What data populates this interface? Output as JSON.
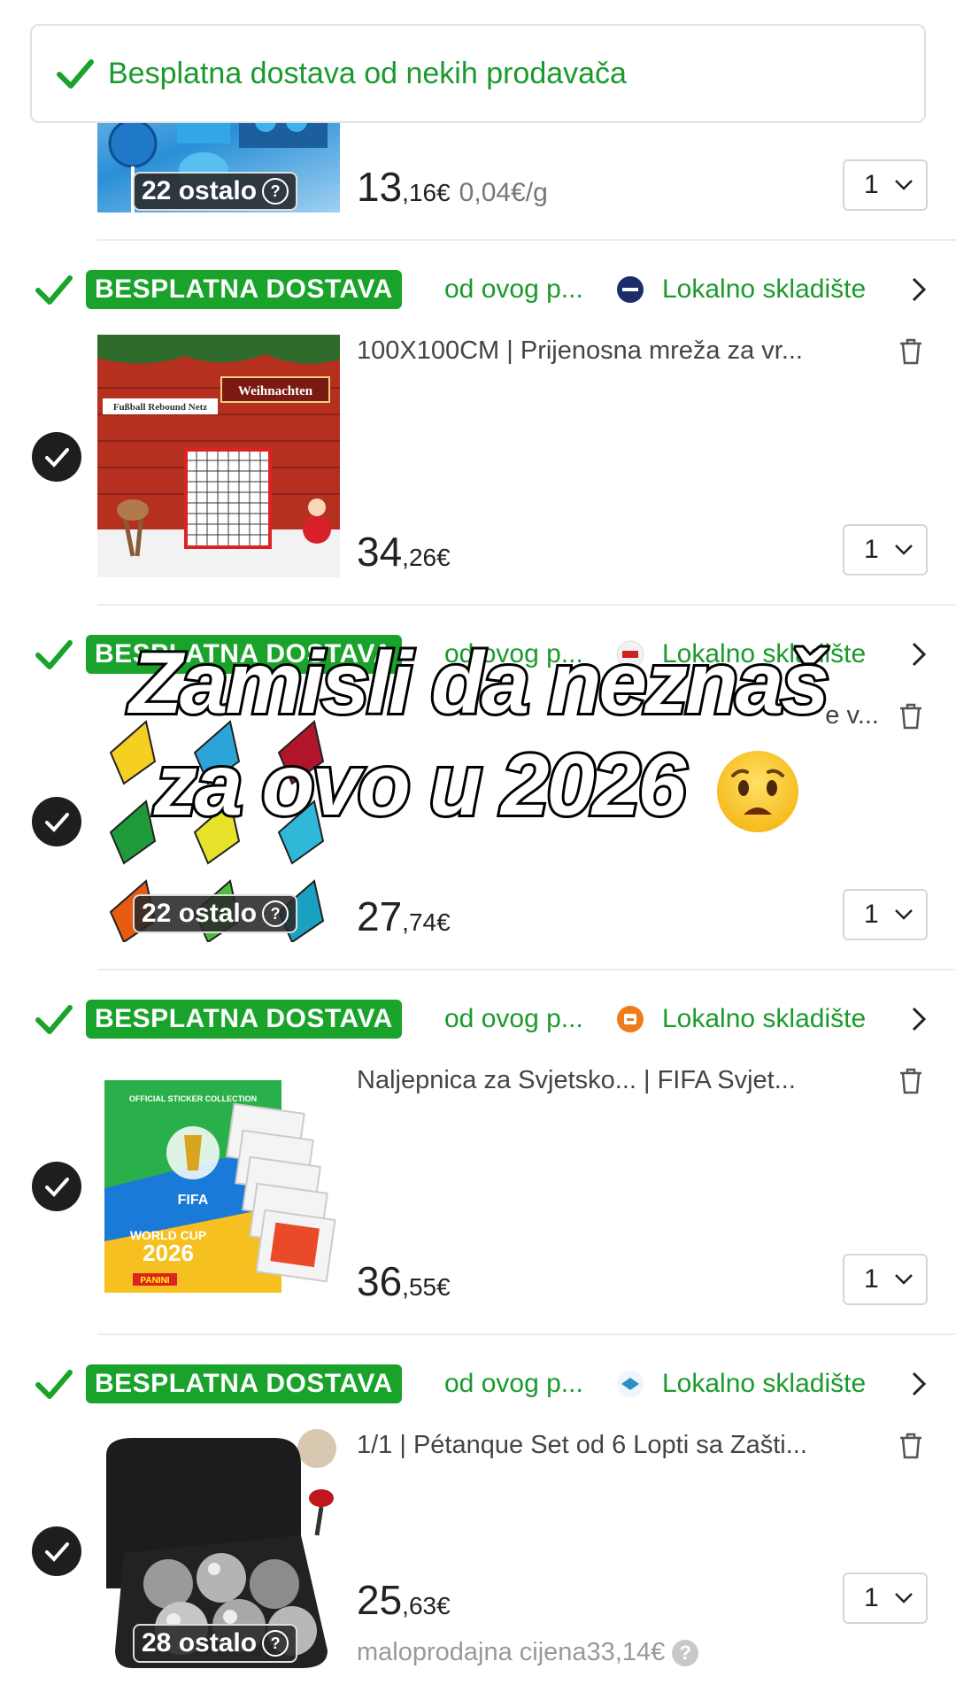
{
  "banner": {
    "text": "Besplatna dostava od nekih prodavača"
  },
  "badge_text": "BESPLATNA DOSTAVA",
  "from_text": "od ovog p...",
  "local_text": "Lokalno skladište",
  "overlay": {
    "line1": "Zamisli da neznaš",
    "line2": "za ovo u 2026"
  },
  "colors": {
    "green": "#1aa32b",
    "text_green": "#1a9a2c"
  },
  "items": [
    {
      "price_int": "13",
      "price_dec": ",16€",
      "unit_price": "0,04€/g",
      "qty": "1",
      "stock": "22 ostalo",
      "image": "lollipop-product-image"
    },
    {
      "title": "100X100CM | Prijenosna mreža za vr...",
      "price_int": "34",
      "price_dec": ",26€",
      "qty": "1",
      "seller_logo": "seller-logo-icon",
      "image": "rebound-net-image",
      "image_texts": {
        "sign": "Weihnachten",
        "label": "Fußball Rebound Netz"
      }
    },
    {
      "title": "...",
      "title_suffix": "e v...",
      "price_int": "27",
      "price_dec": ",74€",
      "qty": "1",
      "stock": "22 ostalo",
      "image": "dart-flights-image"
    },
    {
      "title": "Naljepnica za Svjetsko... | FIFA Svjet...",
      "price_int": "36",
      "price_dec": ",55€",
      "qty": "1",
      "image": "sticker-album-image",
      "image_texts": {
        "top": "OFFICIAL STICKER COLLECTION",
        "fifa": "FIFA",
        "wc": "WORLD CUP",
        "year": "2026",
        "brand": "PANINI"
      }
    },
    {
      "title": "1/1 | Pétanque Set od 6 Lopti sa Zašti...",
      "price_int": "25",
      "price_dec": ",63€",
      "qty": "1",
      "stock": "28 ostalo",
      "retail": "maloprodajna cijena33,14€",
      "image": "petanque-set-image"
    }
  ]
}
